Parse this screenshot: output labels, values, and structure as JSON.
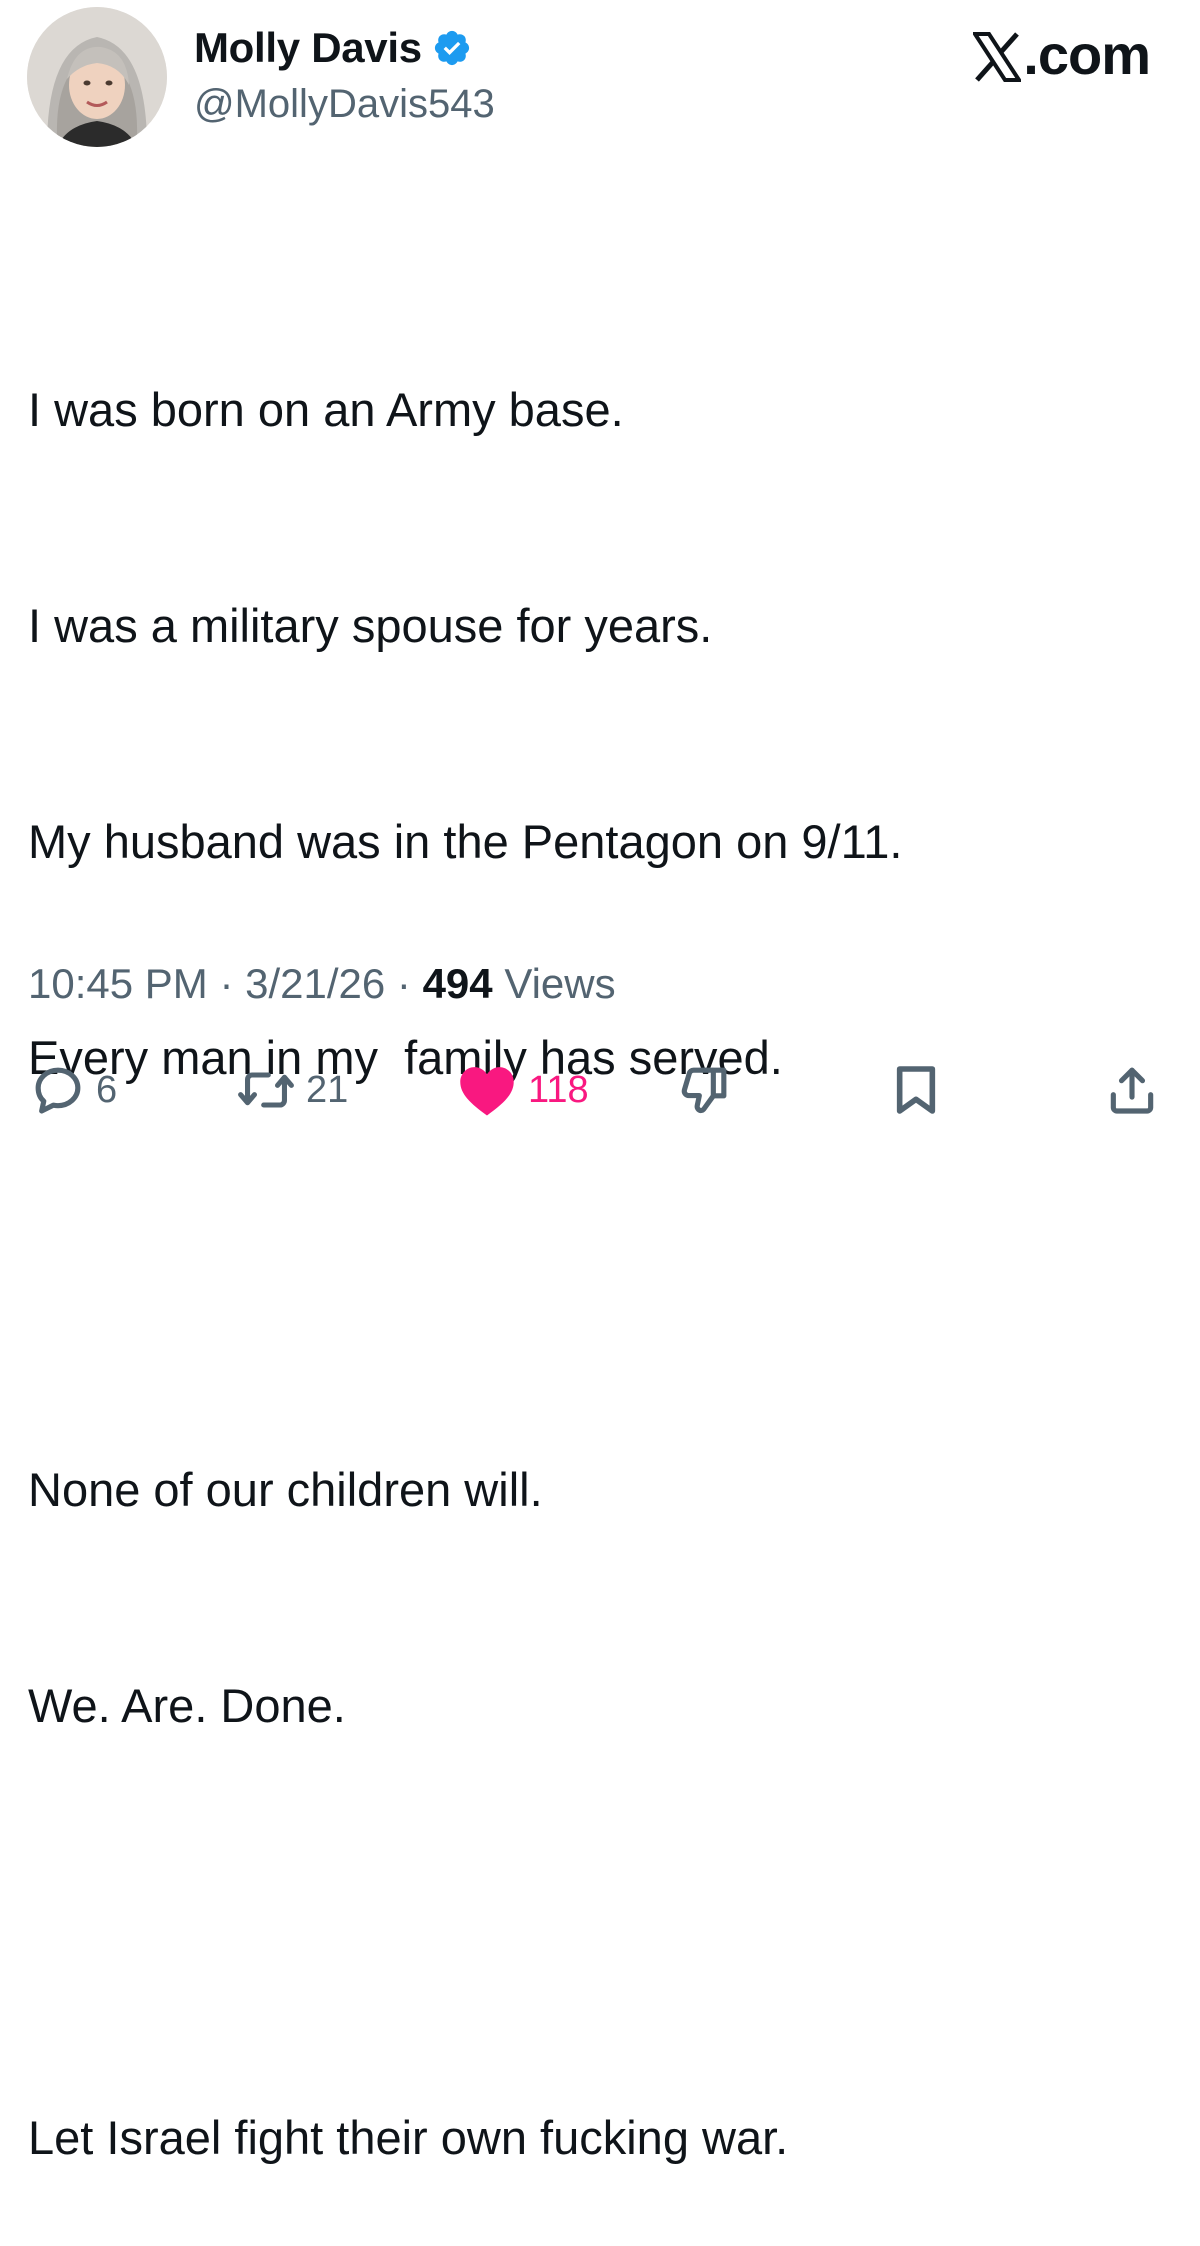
{
  "header": {
    "display_name": "Molly Davis",
    "handle": "@MollyDavis543",
    "brand": ".com",
    "verified_color": "#1d9bf0"
  },
  "tweet": {
    "paragraphs": [
      [
        "I was born on an Army base.",
        "I was a military spouse for years.",
        "My husband was in the Pentagon on 9/11.",
        "Every man in my  family has served."
      ],
      [
        "None of our children will.",
        "We. Are. Done."
      ],
      [
        "Let Israel fight their own fucking war."
      ]
    ]
  },
  "meta": {
    "time": "10:45 PM",
    "separator": " · ",
    "date": "3/21/26",
    "views_count": "494",
    "views_label": " Views"
  },
  "actions": {
    "reply_count": "6",
    "repost_count": "21",
    "like_count": "118",
    "like_color": "#f91880",
    "icons": [
      "reply-icon",
      "repost-icon",
      "heart-icon",
      "dislike-icon",
      "bookmark-icon",
      "share-icon"
    ]
  }
}
